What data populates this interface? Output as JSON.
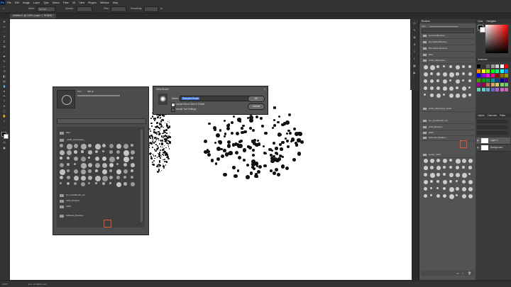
{
  "menu": {
    "logo": "Ps",
    "items": [
      "File",
      "Edit",
      "Image",
      "Layer",
      "Type",
      "Select",
      "Filter",
      "3D",
      "View",
      "Plugins",
      "Window",
      "Help"
    ]
  },
  "options": {
    "mode_label": "Mode:",
    "mode_value": "Normal",
    "opacity_label": "Opacity:",
    "flow_label": "Flow:",
    "smoothing_label": "Smoothing:"
  },
  "document": {
    "tab_title": "Untitled-1 @ 100% (Layer 1, RGB/8) *"
  },
  "status": {
    "zoom": "100%",
    "doc_info": "Doc: 24.9M/0 bytes"
  },
  "brush_picker": {
    "size_value": "400 px",
    "folders": [
      "Misc",
      "_1035_subtonique_",
      "lon_pencilbrush_set",
      "1034_Brushes",
      "1000",
      "Subtonix_Brushes"
    ]
  },
  "new_brush_dialog": {
    "title": "New Brush",
    "name_label": "Name:",
    "name_value": "Sampled Brush",
    "ok_label": "OK",
    "cancel_label": "Cancel",
    "capture_label": "Capture Brush Size in Preset",
    "include_label": "Include Tool Settings"
  },
  "brushes_panel": {
    "title": "Brushes",
    "size_label": "Size:",
    "folders": [
      "General Brushes",
      "Dry Media Brushes",
      "Wet Media Brushes",
      "Misc",
      "1035_subtonique_",
      "1040_subtonique_brush",
      "lon_pencilbrush_set",
      "1034_Brushes",
      "1000",
      "Subtonix_Brushes",
      "stroke_1000"
    ]
  },
  "right_column": {
    "color_tab": "Color",
    "navigator_tab": "Navigator",
    "swatches_tab": "Swatches",
    "layers_tab": "Layers",
    "channels_tab": "Channels",
    "paths_tab": "Paths",
    "layers": [
      "Layer 1",
      "Background"
    ]
  },
  "colors": {
    "canvas": "#ffffff",
    "ui_dark": "#323232",
    "selection": "#2f6bd1",
    "ps_blue": "#31a8ff"
  }
}
